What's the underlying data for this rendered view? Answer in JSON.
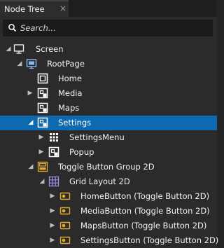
{
  "panel": {
    "title": "Node Tree",
    "close_glyph": "×"
  },
  "search": {
    "placeholder": "Search...",
    "value": ""
  },
  "colors": {
    "selected_row": "#0e6ab0",
    "panel_bg": "#2b2b2b",
    "button_icon": "#e6a92f",
    "grid_icon": "#9b8ee0"
  },
  "tree": [
    {
      "label": "Screen",
      "icon": "monitor-icon",
      "expanded": true
    },
    {
      "label": "RootPage",
      "icon": "page-icon",
      "expanded": true
    },
    {
      "label": "Home",
      "icon": "page-outline-icon",
      "expanded": null
    },
    {
      "label": "Media",
      "icon": "page-component-icon",
      "expanded": false
    },
    {
      "label": "Maps",
      "icon": "page-component-icon",
      "expanded": null
    },
    {
      "label": "Settings",
      "icon": "page-component-icon",
      "expanded": true,
      "selected": true
    },
    {
      "label": "SettingsMenu",
      "icon": "grid-dots-icon",
      "expanded": false
    },
    {
      "label": "Popup",
      "icon": "page-component-icon",
      "expanded": false
    },
    {
      "label": "Toggle Button Group 2D",
      "icon": "toggle-group-icon",
      "expanded": true
    },
    {
      "label": "Grid Layout 2D",
      "icon": "grid-layout-icon",
      "expanded": true
    },
    {
      "label": "HomeButton (Toggle Button 2D)",
      "icon": "toggle-button-icon",
      "expanded": false
    },
    {
      "label": "MediaButton (Toggle Button 2D)",
      "icon": "toggle-button-icon",
      "expanded": false
    },
    {
      "label": "MapsButton (Toggle Button 2D)",
      "icon": "toggle-button-icon",
      "expanded": false
    },
    {
      "label": "SettingsButton (Toggle Button 2D)",
      "icon": "toggle-button-icon",
      "expanded": false
    }
  ]
}
